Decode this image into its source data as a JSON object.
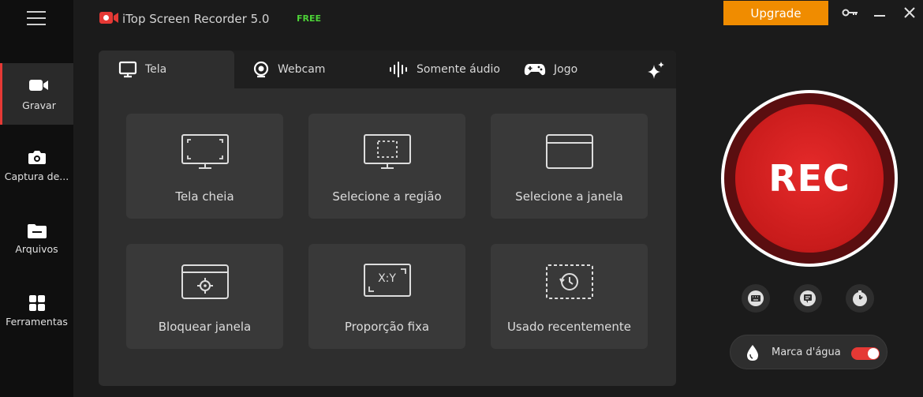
{
  "app": {
    "title": "iTop Screen Recorder 5.0",
    "badge": "FREE",
    "upgrade_label": "Upgrade"
  },
  "sidebar": {
    "items": [
      {
        "label": "Gravar",
        "icon": "video-camera-icon",
        "active": true
      },
      {
        "label": "Captura de...",
        "icon": "camera-icon",
        "active": false
      },
      {
        "label": "Arquivos",
        "icon": "folder-icon",
        "active": false
      },
      {
        "label": "Ferramentas",
        "icon": "grid-tools-icon",
        "active": false
      }
    ]
  },
  "tabs": [
    {
      "label": "Tela",
      "icon": "monitor-icon",
      "active": true
    },
    {
      "label": "Webcam",
      "icon": "webcam-icon",
      "active": false
    },
    {
      "label": "Somente áudio",
      "icon": "audio-wave-icon",
      "active": false
    },
    {
      "label": "Jogo",
      "icon": "gamepad-icon",
      "active": false
    }
  ],
  "modes": [
    {
      "label": "Tela cheia",
      "icon": "fullscreen-icon"
    },
    {
      "label": "Selecione a região",
      "icon": "select-region-icon"
    },
    {
      "label": "Selecione a janela",
      "icon": "select-window-icon"
    },
    {
      "label": "Bloquear janela",
      "icon": "lock-window-icon"
    },
    {
      "label": "Proporção fixa",
      "icon": "fixed-ratio-icon",
      "icon_text": "X:Y"
    },
    {
      "label": "Usado recentemente",
      "icon": "recent-history-icon"
    }
  ],
  "rec": {
    "label": "REC"
  },
  "tools": [
    "keyboard-icon",
    "subtitle-icon",
    "timer-icon"
  ],
  "watermark": {
    "label": "Marca d'água",
    "enabled": true
  },
  "colors": {
    "accent": "#e53935",
    "upgrade": "#f08c00",
    "free": "#4cd137",
    "rec_fill": "#c81b1b"
  }
}
